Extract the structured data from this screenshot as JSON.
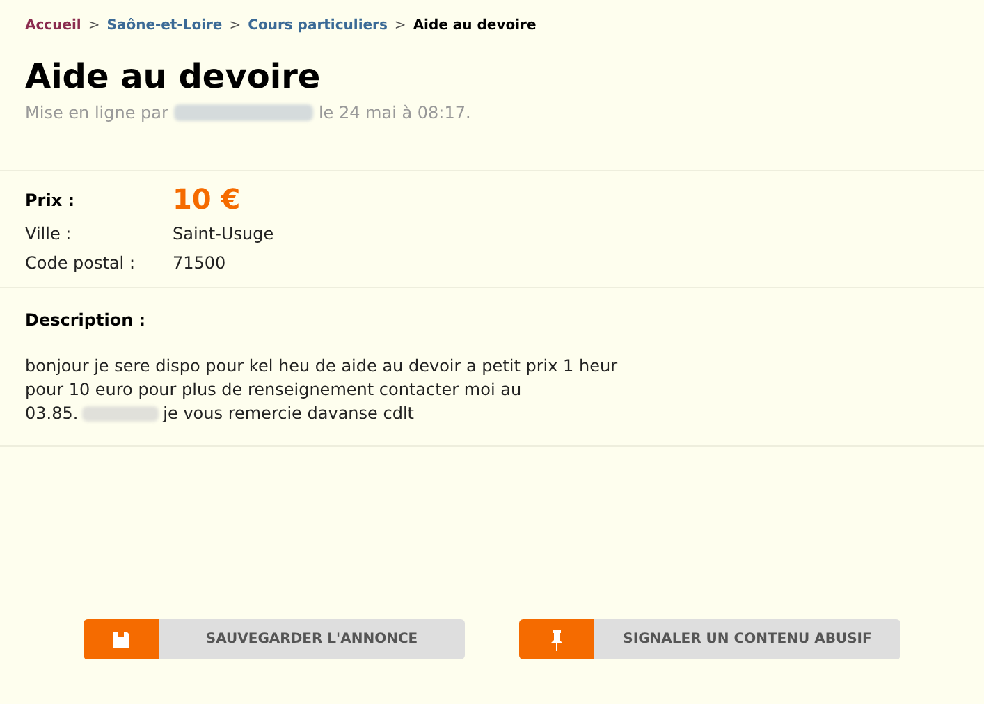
{
  "breadcrumb": [
    {
      "label": "Accueil",
      "kind": "home"
    },
    {
      "label": "Saône-et-Loire",
      "kind": "link"
    },
    {
      "label": "Cours particuliers",
      "kind": "link"
    },
    {
      "label": "Aide au devoire",
      "kind": "current"
    }
  ],
  "breadcrumb_separator": ">",
  "title": "Aide au devoire",
  "posted": {
    "before": "Mise en ligne par",
    "after": "le 24 mai à 08:17."
  },
  "details": [
    {
      "label": "Prix :",
      "value": "10 €",
      "kind": "price"
    },
    {
      "label": "Ville :",
      "value": "Saint-Usuge",
      "kind": "text"
    },
    {
      "label": "Code postal :",
      "value": "71500",
      "kind": "text"
    }
  ],
  "description": {
    "heading": "Description :",
    "lines": [
      "bonjour je sere dispo pour kel heu de aide au devoir a petit prix 1 heur",
      "pour 10 euro pour plus de renseignement contacter moi au",
      "03.85."
    ],
    "after_redacted": "je vous remercie davanse cdlt"
  },
  "buttons": [
    {
      "label": "SAUVEGARDER L'ANNONCE",
      "kind": "save"
    },
    {
      "label": "SIGNALER UN CONTENU ABUSIF",
      "kind": "report"
    }
  ]
}
